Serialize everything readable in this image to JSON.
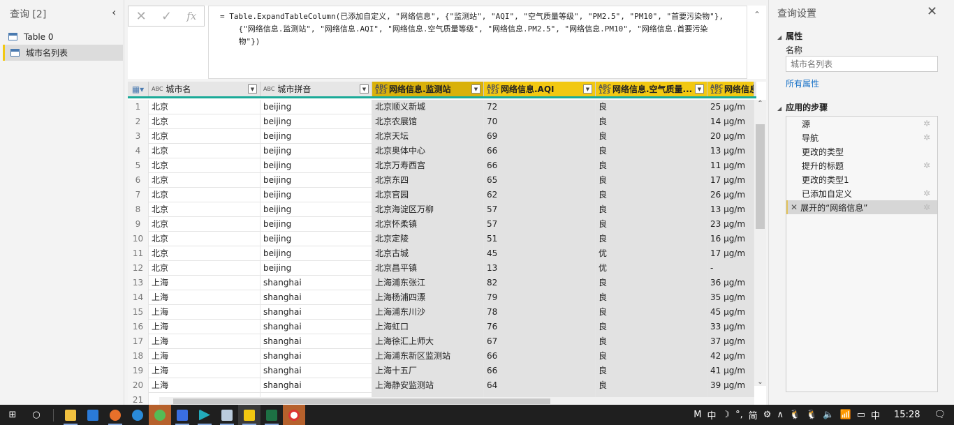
{
  "queries": {
    "title": "查询 [2]",
    "items": [
      "Table 0",
      "城市名列表"
    ]
  },
  "formula": {
    "text": "= Table.ExpandTableColumn(已添加自定义, \"网络信息\", {\"监测站\", \"AQI\", \"空气质量等级\", \"PM2.5\", \"PM10\", \"首要污染物\"},\n    {\"网络信息.监测站\", \"网络信息.AQI\", \"网络信息.空气质量等级\", \"网络信息.PM2.5\", \"网络信息.PM10\", \"网络信息.首要污染\n    物\"})",
    "cancel": "✕",
    "confirm": "✓",
    "fx": "fx"
  },
  "columns": [
    {
      "label": "城市名",
      "type": "ABC"
    },
    {
      "label": "城市拼音",
      "type": "ABC"
    },
    {
      "label": "网络信息.监测站",
      "type": "ABC 123"
    },
    {
      "label": "网络信息.AQI",
      "type": "ABC 123"
    },
    {
      "label": "网络信息.空气质量...",
      "type": "ABC 123"
    },
    {
      "label": "网络信息.P",
      "type": "ABC 123"
    }
  ],
  "rows": [
    [
      "1",
      "北京",
      "beijing",
      "北京顺义新城",
      "72",
      "良",
      "25 µg/m"
    ],
    [
      "2",
      "北京",
      "beijing",
      "北京农展馆",
      "70",
      "良",
      "14 µg/m"
    ],
    [
      "3",
      "北京",
      "beijing",
      "北京天坛",
      "69",
      "良",
      "20 µg/m"
    ],
    [
      "4",
      "北京",
      "beijing",
      "北京奥体中心",
      "66",
      "良",
      "13 µg/m"
    ],
    [
      "5",
      "北京",
      "beijing",
      "北京万寿西宫",
      "66",
      "良",
      "11 µg/m"
    ],
    [
      "6",
      "北京",
      "beijing",
      "北京东四",
      "65",
      "良",
      "17 µg/m"
    ],
    [
      "7",
      "北京",
      "beijing",
      "北京官园",
      "62",
      "良",
      "26 µg/m"
    ],
    [
      "8",
      "北京",
      "beijing",
      "北京海淀区万柳",
      "57",
      "良",
      "13 µg/m"
    ],
    [
      "9",
      "北京",
      "beijing",
      "北京怀柔镇",
      "57",
      "良",
      "23 µg/m"
    ],
    [
      "10",
      "北京",
      "beijing",
      "北京定陵",
      "51",
      "良",
      "16 µg/m"
    ],
    [
      "11",
      "北京",
      "beijing",
      "北京古城",
      "45",
      "优",
      "17 µg/m"
    ],
    [
      "12",
      "北京",
      "beijing",
      "北京昌平镇",
      "13",
      "优",
      "-"
    ],
    [
      "13",
      "上海",
      "shanghai",
      "上海浦东张江",
      "82",
      "良",
      "36 µg/m"
    ],
    [
      "14",
      "上海",
      "shanghai",
      "上海杨浦四漂",
      "79",
      "良",
      "35 µg/m"
    ],
    [
      "15",
      "上海",
      "shanghai",
      "上海浦东川沙",
      "78",
      "良",
      "45 µg/m"
    ],
    [
      "16",
      "上海",
      "shanghai",
      "上海虹口",
      "76",
      "良",
      "33 µg/m"
    ],
    [
      "17",
      "上海",
      "shanghai",
      "上海徐汇上师大",
      "67",
      "良",
      "37 µg/m"
    ],
    [
      "18",
      "上海",
      "shanghai",
      "上海浦东新区监测站",
      "66",
      "良",
      "42 µg/m"
    ],
    [
      "19",
      "上海",
      "shanghai",
      "上海十五厂",
      "66",
      "良",
      "41 µg/m"
    ],
    [
      "20",
      "上海",
      "shanghai",
      "上海静安监测站",
      "64",
      "良",
      "39 µg/m"
    ],
    [
      "21",
      "",
      "",
      "",
      "",
      "",
      ""
    ]
  ],
  "settings": {
    "title": "查询设置",
    "close": "✕",
    "properties": "属性",
    "name_label": "名称",
    "name_value": "城市名列表",
    "all_properties": "所有属性",
    "applied_steps": "应用的步骤",
    "steps": [
      {
        "label": "源",
        "gear": true
      },
      {
        "label": "导航",
        "gear": true
      },
      {
        "label": "更改的类型",
        "gear": false
      },
      {
        "label": "提升的标题",
        "gear": true
      },
      {
        "label": "更改的类型1",
        "gear": false
      },
      {
        "label": "已添加自定义",
        "gear": true
      },
      {
        "label": "展开的“网络信息”",
        "gear": true,
        "selected": true
      }
    ]
  },
  "taskbar": {
    "tray": [
      "M",
      "中",
      "☽",
      "°,",
      "简",
      "⚙",
      "∧",
      "🐧",
      "🐧",
      "🔈",
      "📶",
      "▭",
      "中"
    ],
    "time": "15:28"
  }
}
